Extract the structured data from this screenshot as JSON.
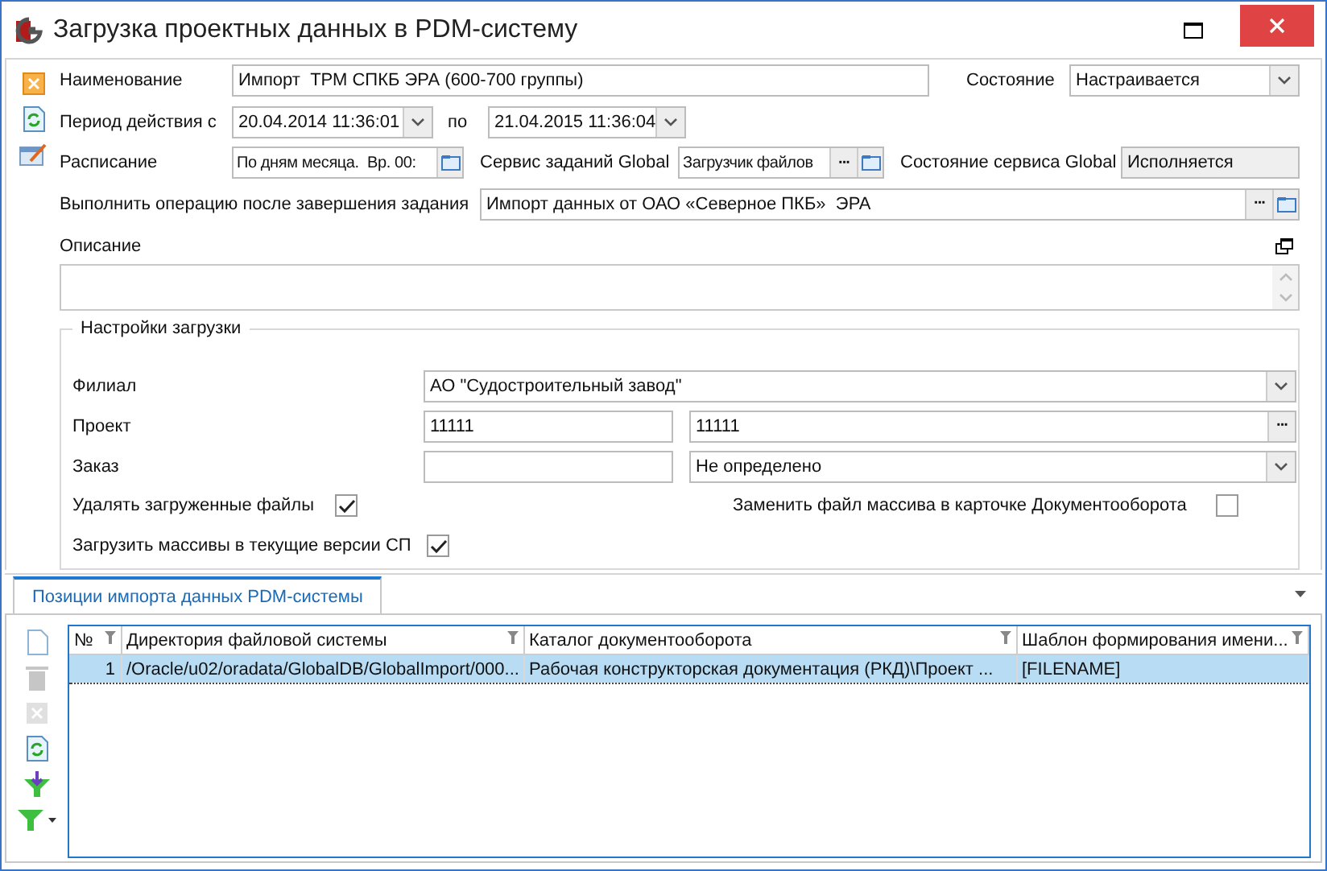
{
  "window": {
    "title": "Загрузка проектных данных в PDM-систему"
  },
  "side_toolbar": [
    {
      "kind": "cancel",
      "disabled": false
    },
    {
      "kind": "refresh",
      "disabled": false
    },
    {
      "kind": "edit",
      "disabled": false
    }
  ],
  "name": {
    "label": "Наименование",
    "value": "Импорт  ТРМ СПКБ ЭРА (600-700 группы)"
  },
  "state": {
    "label": "Состояние",
    "value": "Настраивается"
  },
  "period": {
    "label": "Период действия с",
    "from": "20.04.2014 11:36:01",
    "to_label": "по",
    "to": "21.04.2015 11:36:04"
  },
  "schedule": {
    "label": "Расписание",
    "value": "По дням месяца.  Вр. 00:"
  },
  "service": {
    "label": "Сервис заданий Global",
    "value": "Загрузчик файлов",
    "more": "···"
  },
  "service_state": {
    "label": "Состояние сервиса Global",
    "value": "Исполняется"
  },
  "after_op": {
    "label": "Выполнить операцию после завершения задания",
    "value": "Импорт данных от ОАО «Северное ПКБ»  ЭРА",
    "more": "···"
  },
  "description": {
    "label": "Описание"
  },
  "settings": {
    "title": "Настройки загрузки",
    "branch": {
      "label": "Филиал",
      "value": "АО \"Судостроительный завод\""
    },
    "project": {
      "label": "Проект",
      "code": "11111",
      "value": "11111",
      "more": "···"
    },
    "order": {
      "label": "Заказ",
      "value": "Не определено"
    },
    "checks": [
      {
        "label": "Удалять загруженные файлы",
        "checked": true
      },
      {
        "label": "Заменить файл массива в карточке Документооборота",
        "checked": false
      },
      {
        "label": "Загрузить массивы в текущие версии СП",
        "checked": true
      }
    ]
  },
  "tabs": [
    {
      "label": "Позиции импорта данных PDM-системы",
      "selected": true
    }
  ],
  "grid_toolbar": [
    {
      "kind": "new",
      "disabled": false
    },
    {
      "kind": "trash",
      "disabled": true
    },
    {
      "kind": "delete",
      "disabled": true
    },
    {
      "kind": "refresh",
      "disabled": false
    },
    {
      "kind": "filter-apply",
      "disabled": false
    },
    {
      "kind": "filter",
      "disabled": false
    }
  ],
  "table": {
    "columns": [
      "№",
      "Директория файловой системы",
      "Каталог документооборота",
      "Шаблон формирования имени..."
    ],
    "rows": [
      {
        "cells": [
          "1",
          "/Oracle/u02/oradata/GlobalDB/GlobalImport/000...",
          "Рабочая конструкторская документация (РКД)\\Проект ...",
          "[FILENAME]"
        ],
        "selected": true
      }
    ]
  }
}
